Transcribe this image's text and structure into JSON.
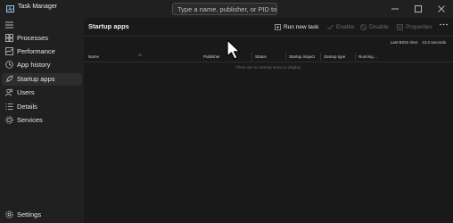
{
  "window": {
    "title": "Task Manager",
    "controls": [
      "minimize-icon",
      "maximize-icon",
      "close-icon"
    ]
  },
  "search": {
    "placeholder": "Type a name, publisher, or PID to search"
  },
  "sidebar": {
    "items": [
      {
        "label": "Processes",
        "icon": "processes-icon",
        "active": false
      },
      {
        "label": "Performance",
        "icon": "performance-icon",
        "active": false
      },
      {
        "label": "App history",
        "icon": "app-history-icon",
        "active": false
      },
      {
        "label": "Startup apps",
        "icon": "startup-apps-icon",
        "active": true
      },
      {
        "label": "Users",
        "icon": "users-icon",
        "active": false
      },
      {
        "label": "Details",
        "icon": "details-icon",
        "active": false
      },
      {
        "label": "Services",
        "icon": "services-icon",
        "active": false
      }
    ],
    "settings_label": "Settings"
  },
  "main": {
    "page_title": "Startup apps",
    "toolbar": {
      "run_new_task": "Run new task",
      "enable": "Enable",
      "disable": "Disable",
      "properties": "Properties"
    },
    "bios_label": "Last BIOS time:",
    "bios_value": "12.0 seconds",
    "columns": [
      "Name",
      "Publisher",
      "Status",
      "Startup impact",
      "Startup type",
      "Running ..."
    ],
    "empty_message": "There are no startup items to display."
  },
  "colors": {
    "background": "#202020",
    "content": "#191919",
    "text": "#e6e6e6",
    "disabled_text": "#6a6a6a"
  }
}
